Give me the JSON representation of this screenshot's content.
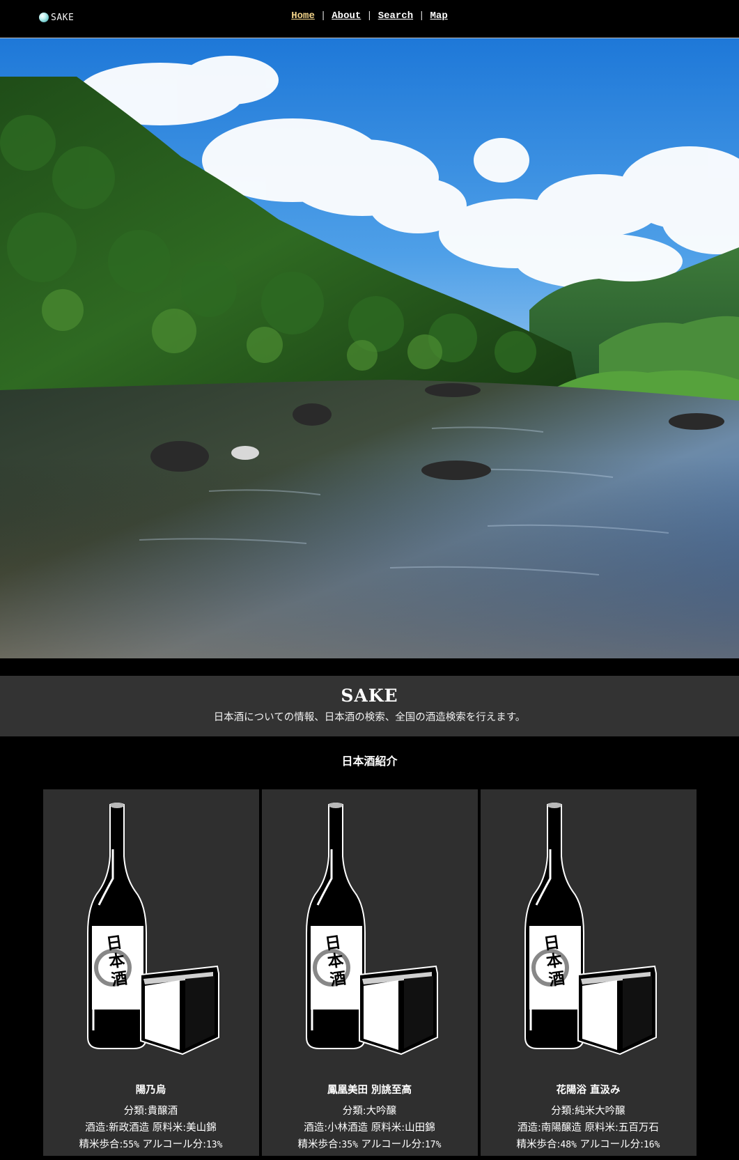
{
  "header": {
    "logo_text": "SAKE",
    "nav": [
      {
        "label": "Home",
        "active": true
      },
      {
        "label": "About",
        "active": false
      },
      {
        "label": "Search",
        "active": false
      },
      {
        "label": "Map",
        "active": false
      }
    ],
    "separator": "|"
  },
  "intro": {
    "title": "SAKE",
    "description": "日本酒についての情報、日本酒の検索、全国の酒造検索を行えます。"
  },
  "section": {
    "title": "日本酒紹介",
    "cards": [
      {
        "name": "陽乃烏",
        "category": "分類:貴醸酒",
        "brewery": "酒造:新政酒造",
        "rice": "原料米:美山錦",
        "polish_label": "精米歩合:",
        "polish_value": "55%",
        "alcohol_label": "アルコール分:",
        "alcohol_value": "13%",
        "label_text": "日本酒"
      },
      {
        "name": "鳳凰美田 別誂至高",
        "category": "分類:大吟醸",
        "brewery": "酒造:小林酒造",
        "rice": "原料米:山田錦",
        "polish_label": "精米歩合:",
        "polish_value": "35%",
        "alcohol_label": "アルコール分:",
        "alcohol_value": "17%",
        "label_text": "日本酒"
      },
      {
        "name": "花陽浴 直汲み",
        "category": "分類:純米大吟醸",
        "brewery": "酒造:南陽醸造",
        "rice": "原料米:五百万石",
        "polish_label": "精米歩合:",
        "polish_value": "48%",
        "alcohol_label": "アルコール分:",
        "alcohol_value": "16%",
        "label_text": "日本酒"
      }
    ]
  },
  "colors": {
    "nav_active": "#f4d58a",
    "intro_bg": "#333333",
    "card_bg": "#2f2f2f"
  },
  "icons": {
    "logo": "logo-orb-icon",
    "card_image": "sake-bottle-and-masu-icon"
  }
}
